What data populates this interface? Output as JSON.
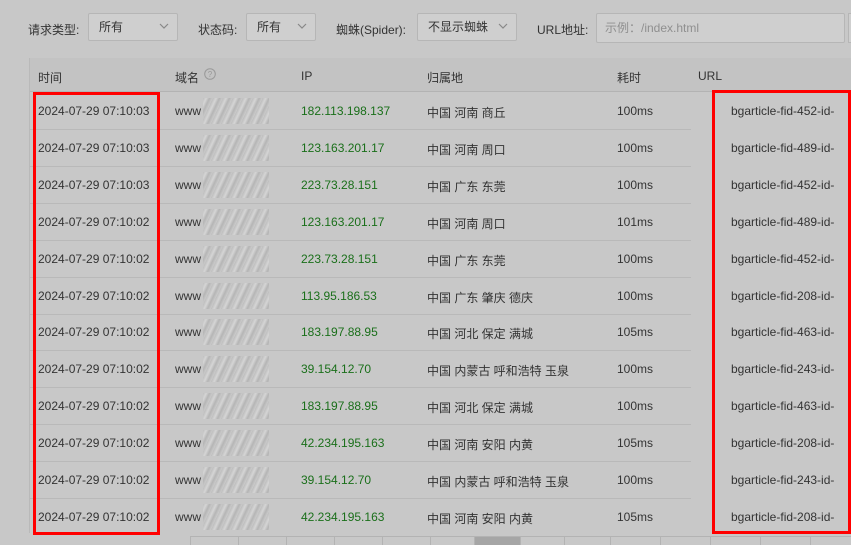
{
  "filters": {
    "request_type": {
      "label": "请求类型:",
      "value": "所有"
    },
    "status_code": {
      "label": "状态码:",
      "value": "所有"
    },
    "spider": {
      "label": "蜘蛛(Spider):",
      "value": "不显示蜘蛛"
    },
    "url": {
      "label": "URL地址:",
      "placeholder": "示例：/index.html"
    }
  },
  "table": {
    "columns": {
      "time": "时间",
      "domain": "域名",
      "ip": "IP",
      "location": "归属地",
      "duration": "耗时",
      "url": "URL"
    },
    "rows": [
      {
        "time": "2024-07-29 07:10:03",
        "domain": "www",
        "ip": "182.113.198.137",
        "location": "中国 河南 商丘",
        "duration": "100ms",
        "url": "bgarticle-fid-452-id-"
      },
      {
        "time": "2024-07-29 07:10:03",
        "domain": "www",
        "ip": "123.163.201.17",
        "location": "中国 河南 周口",
        "duration": "100ms",
        "url": "bgarticle-fid-489-id-"
      },
      {
        "time": "2024-07-29 07:10:03",
        "domain": "www",
        "ip": "223.73.28.151",
        "location": "中国 广东 东莞",
        "duration": "100ms",
        "url": "bgarticle-fid-452-id-"
      },
      {
        "time": "2024-07-29 07:10:02",
        "domain": "www",
        "ip": "123.163.201.17",
        "location": "中国 河南 周口",
        "duration": "101ms",
        "url": "bgarticle-fid-489-id-"
      },
      {
        "time": "2024-07-29 07:10:02",
        "domain": "www",
        "ip": "223.73.28.151",
        "location": "中国 广东 东莞",
        "duration": "100ms",
        "url": "bgarticle-fid-452-id-"
      },
      {
        "time": "2024-07-29 07:10:02",
        "domain": "www",
        "ip": "113.95.186.53",
        "location": "中国 广东 肇庆 德庆",
        "duration": "100ms",
        "url": "bgarticle-fid-208-id-"
      },
      {
        "time": "2024-07-29 07:10:02",
        "domain": "www",
        "ip": "183.197.88.95",
        "location": "中国 河北 保定 满城",
        "duration": "105ms",
        "url": "bgarticle-fid-463-id-"
      },
      {
        "time": "2024-07-29 07:10:02",
        "domain": "www",
        "ip": "39.154.12.70",
        "location": "中国 内蒙古 呼和浩特 玉泉",
        "duration": "100ms",
        "url": "bgarticle-fid-243-id-"
      },
      {
        "time": "2024-07-29 07:10:02",
        "domain": "www",
        "ip": "183.197.88.95",
        "location": "中国 河北 保定 满城",
        "duration": "100ms",
        "url": "bgarticle-fid-463-id-"
      },
      {
        "time": "2024-07-29 07:10:02",
        "domain": "www",
        "ip": "42.234.195.163",
        "location": "中国 河南 安阳 内黄",
        "duration": "105ms",
        "url": "bgarticle-fid-208-id-"
      },
      {
        "time": "2024-07-29 07:10:02",
        "domain": "www",
        "ip": "39.154.12.70",
        "location": "中国 内蒙古 呼和浩特 玉泉",
        "duration": "100ms",
        "url": "bgarticle-fid-243-id-"
      },
      {
        "time": "2024-07-29 07:10:02",
        "domain": "www",
        "ip": "42.234.195.163",
        "location": "中国 河南 安阳 内黄",
        "duration": "105ms",
        "url": "bgarticle-fid-208-id-"
      }
    ]
  },
  "colors": {
    "highlight": "#ff0000",
    "ip_text": "#1a6f1a"
  }
}
